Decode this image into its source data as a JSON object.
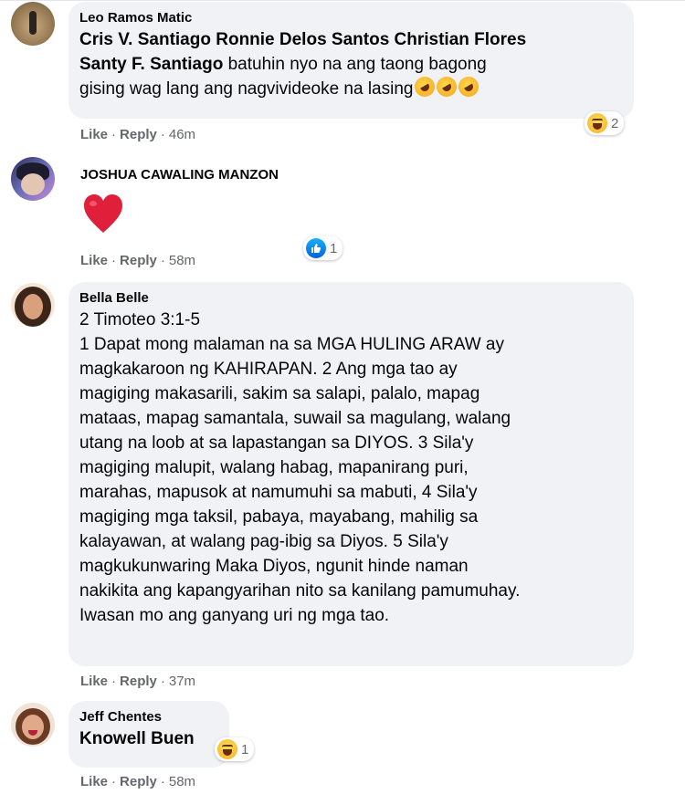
{
  "comments": [
    {
      "author": "Leo Ramos Matic",
      "mention_line1": "Cris V. Santiago Ronnie Delos Santos Christian Flores",
      "mention_line2": "Santy F. Santiago",
      "text_line2": " batuhin nyo na ang taong bagong",
      "text_line3": "gising wag lang ang nagvivideoke na lasing",
      "emojis": [
        "rolling-on-floor-laughing",
        "rolling-on-floor-laughing",
        "rolling-on-floor-laughing"
      ],
      "actions": {
        "like": "Like",
        "reply": "Reply",
        "time": "46m"
      },
      "reaction": {
        "icon": "haha-reaction-icon",
        "count": "2"
      }
    },
    {
      "author": "JOSHUA CAWALING MANZON",
      "content_icon": "red-heart-emoji",
      "actions": {
        "like": "Like",
        "reply": "Reply",
        "time": "58m"
      },
      "reaction": {
        "icon": "like-reaction-icon",
        "count": "1"
      }
    },
    {
      "author": "Bella Belle",
      "lines": [
        "2 Timoteo 3:1-5",
        "1 Dapat mong malaman na sa MGA HULING ARAW ay",
        "magkakaroon ng KAHIRAPAN. 2 Ang mga tao ay",
        "magiging makasarili, sakim sa salapi, palalo, mapag",
        "mataas, mapag samantala, suwail sa magulang, walang",
        "utang na loob at sa lapastangan sa DIYOS. 3 Sila'y",
        "magiging malupit, walang habag, mapanirang puri,",
        "marahas, mapusok at namumuhi sa mabuti, 4 Sila'y",
        "magiging mga taksil, pabaya, mayabang, mahilig sa",
        "kalayawan, at walang pag-ibig sa Diyos. 5 Sila'y",
        "magkukunwaring Maka Diyos, ngunit hinde naman",
        "nakikita ang kapangyarihan nito sa kanilang pamumuhay.",
        "Iwasan mo ang ganyang uri ng mga tao."
      ],
      "actions": {
        "like": "Like",
        "reply": "Reply",
        "time": "37m"
      }
    },
    {
      "author": "Jeff Chentes",
      "mention": "Knowell Buen",
      "actions": {
        "like": "Like",
        "reply": "Reply",
        "time": "58m"
      },
      "reaction": {
        "icon": "haha-reaction-icon",
        "count": "1"
      }
    }
  ],
  "separator": "·",
  "colors": {
    "bubble": "#f0f2f5",
    "meta": "#65676b",
    "like_blue": "#1877f2",
    "heart_red": "#e0203a"
  }
}
